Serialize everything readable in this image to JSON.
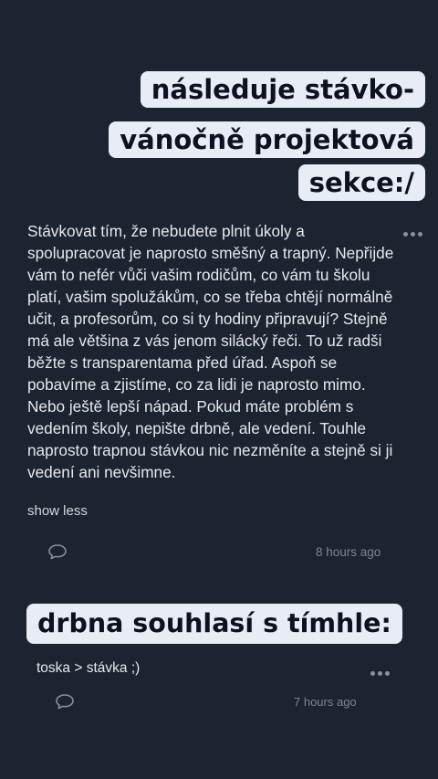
{
  "heading1": {
    "line1": "následuje stávko-",
    "line2": "vánočně projektová",
    "line3": "sekce:/"
  },
  "comment1": {
    "text": "Stávkovat tím, že nebudete plnit úkoly a spolupracovat je naprosto směšný a trapný. Nepřijde vám to nefér vůči vašim rodičům, co vám tu školu platí, vašim spolužákům, co se třeba chtějí normálně učit, a profesorům, co si ty hodiny připravují? Stejně má ale většina z vás jenom silácký řeči. To už radši běžte s transparentama před úřad. Aspoň se pobavíme a zjistíme, co za lidi je naprosto mimo. Nebo ještě lepší nápad. Pokud máte problém s vedením školy, nepište drbně, ale vedení. Touhle naprosto trapnou stávkou nic nezměníte a stejně si ji vedení ani nevšimne.",
    "toggle": "show less",
    "time": "8 hours ago",
    "more_icon": "more-horizontal-icon",
    "reply_icon": "speech-bubble-icon"
  },
  "heading2": {
    "line1": "drbna souhlasí s tímhle:"
  },
  "comment2": {
    "text": "toska > stávka ;)",
    "time": "7 hours ago",
    "more_icon": "more-horizontal-icon",
    "reply_icon": "speech-bubble-icon"
  },
  "colors": {
    "background": "#1c2331",
    "highlight": "#e8ecf4",
    "highlight_text": "#0d1220",
    "text": "#e6e8ec",
    "muted": "#7d8492"
  }
}
